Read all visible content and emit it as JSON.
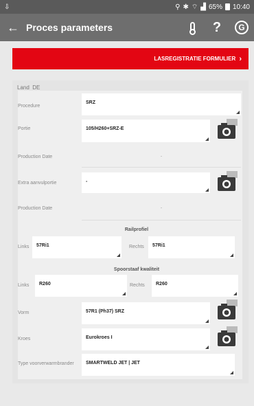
{
  "status_bar": {
    "time": "10:40",
    "battery": "65%",
    "icons": [
      "location-icon",
      "bluetooth-icon",
      "mute-icon",
      "wifi-icon",
      "signal-icon",
      "battery-icon"
    ]
  },
  "app_bar": {
    "title": "Proces parameters",
    "back_icon": "arrow-left-icon",
    "actions": [
      "thermometer-icon",
      "help-icon",
      "app-logo-icon"
    ]
  },
  "banner": {
    "label": "LASREGISTRATIE FORMULIER",
    "chevron": "›",
    "color": "#e30613"
  },
  "form": {
    "land_label": "Land",
    "land_value": "DE",
    "procedure_label": "Procedure",
    "procedure_value": "SRZ",
    "portie_label": "Portie",
    "portie_value": "105/H260+SRZ-E",
    "production_date_label": "Production Date",
    "production_date_value": "-",
    "extra_label": "Extra aanvulportie",
    "extra_value": "-",
    "production_date2_label": "Production Date",
    "production_date2_value": "-",
    "railprofiel_title": "Railprofiel",
    "links_label": "Links",
    "links_value": "57Ri1",
    "rechts_label": "Rechts",
    "rechts_value": "57Ri1",
    "spoorstaaf_title": "Spoorstaaf kwaliteit",
    "links2_label": "Links",
    "links2_value": "R260",
    "rechts2_label": "Rechts",
    "rechts2_value": "R260",
    "vorm_label": "Vorm",
    "vorm_value": "57R1 (Ph37) SRZ",
    "kroes_label": "Kroes",
    "kroes_value": "Eurokroes  I",
    "type_label": "Type voorverwarmbrander",
    "type_value": "SMARTWELD JET | JET"
  }
}
